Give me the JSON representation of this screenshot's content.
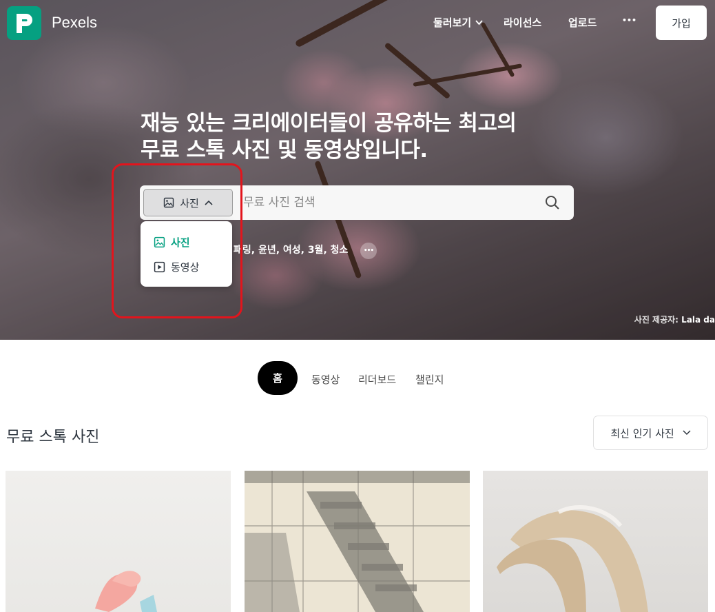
{
  "brand": {
    "name": "Pexels",
    "accent": "#05a081"
  },
  "nav": {
    "explore": "둘러보기",
    "license": "라이선스",
    "upload": "업로드",
    "more": "•••",
    "signup": "가입"
  },
  "hero": {
    "headline_line1": "재능 있는 크리에이터들이 공유하는 최고의",
    "headline_line2": "무료 스톡 사진 및 동영상입니다.",
    "credit_label": "사진 제공자:",
    "credit_name": "Lala da"
  },
  "search": {
    "type_selected": "사진",
    "placeholder": "무료 사진 검색",
    "dropdown": [
      {
        "label": "사진",
        "icon": "image-icon",
        "active": true
      },
      {
        "label": "동영상",
        "icon": "play-icon",
        "active": false
      }
    ],
    "trending": "패링, 윤년, 여성, 3월, 청소",
    "trending_more": "•••"
  },
  "tabs": [
    "홈",
    "동영상",
    "리더보드",
    "챌린지"
  ],
  "section": {
    "title": "무료 스톡 사진",
    "sort": "최신 인기 사진"
  }
}
